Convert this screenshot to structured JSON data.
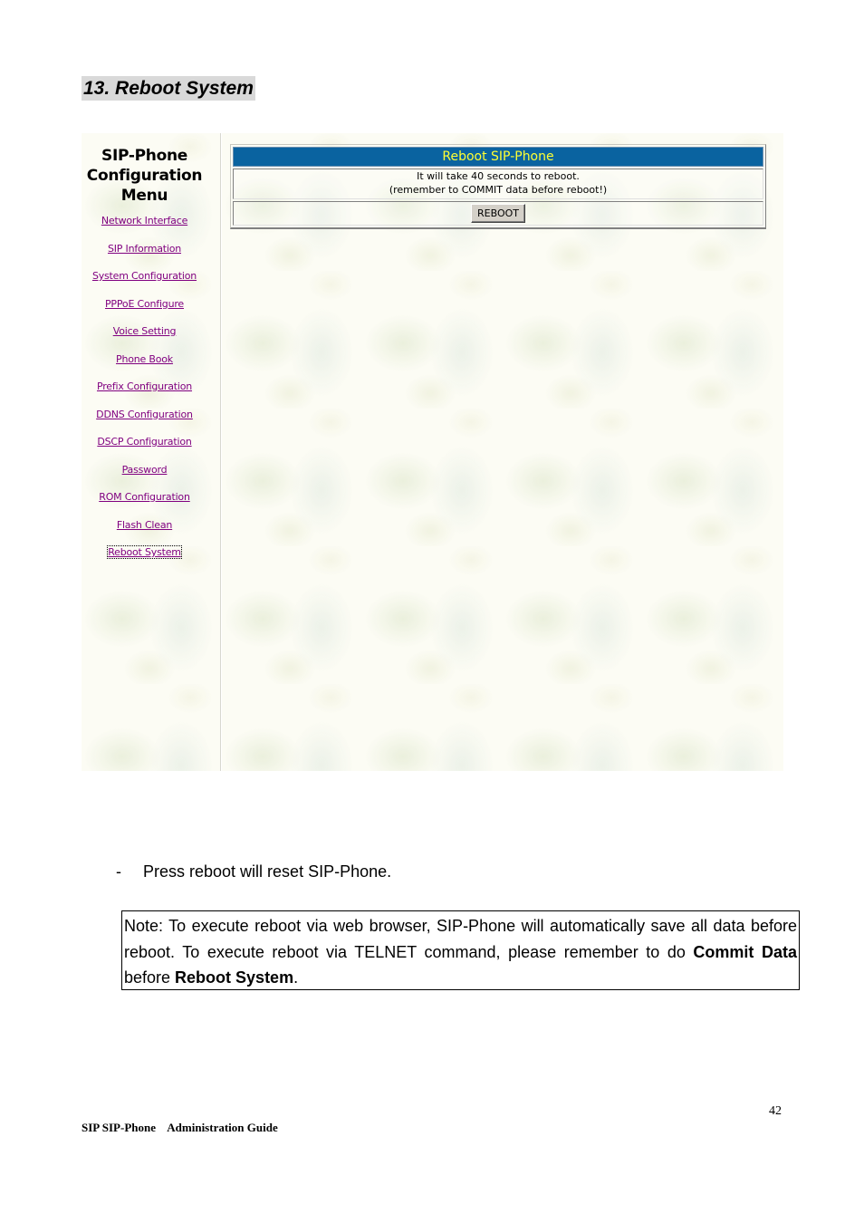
{
  "section": {
    "heading": "13. Reboot System"
  },
  "screenshot": {
    "sidebar": {
      "title_lines": [
        "SIP-Phone",
        "Configuration",
        "Menu"
      ],
      "items": [
        {
          "label": "Network Interface",
          "active": false
        },
        {
          "label": "SIP Information",
          "active": false
        },
        {
          "label": "System Configuration",
          "active": false
        },
        {
          "label": "PPPoE Configure",
          "active": false
        },
        {
          "label": "Voice Setting",
          "active": false
        },
        {
          "label": "Phone Book",
          "active": false
        },
        {
          "label": "Prefix Configuration",
          "active": false
        },
        {
          "label": "DDNS Configuration",
          "active": false
        },
        {
          "label": "DSCP Configuration",
          "active": false
        },
        {
          "label": "Password",
          "active": false
        },
        {
          "label": "ROM Configuration",
          "active": false
        },
        {
          "label": "Flash Clean",
          "active": false
        },
        {
          "label": "Reboot System",
          "active": true
        }
      ],
      "link_color": "#800080"
    },
    "panel": {
      "title": "Reboot SIP-Phone",
      "message_lines": [
        "It will take 40 seconds to reboot.",
        "(remember to COMMIT data before reboot!)"
      ],
      "button_label": "REBOOT",
      "header_color": "#0a63a0",
      "title_color": "#ffff33"
    }
  },
  "body": {
    "bullet": {
      "marker": "-",
      "text": "Press reboot will reset SIP-Phone."
    },
    "note": {
      "text_before": "Note: To execute reboot via web browser, SIP-Phone will automatically save all data before reboot. To execute reboot via TELNET command, please remember to do ",
      "bold_1": "Commit Data",
      "text_middle": " before ",
      "bold_2": "Reboot System",
      "text_after": "."
    }
  },
  "footer": {
    "page_number": "42",
    "title": "SIP SIP-Phone    Administration Guide"
  }
}
